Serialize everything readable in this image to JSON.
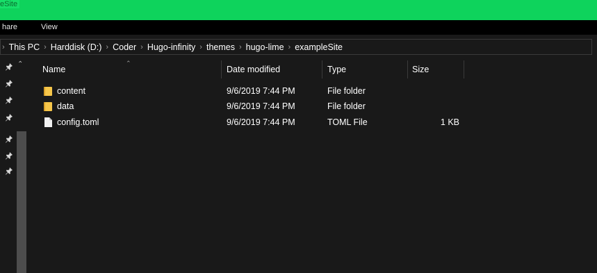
{
  "window": {
    "title": "eSite"
  },
  "ribbon": {
    "tabs": [
      "hare",
      "View"
    ]
  },
  "address": {
    "crumbs": [
      "This PC",
      "Harddisk (D:)",
      "Coder",
      "Hugo-infinity",
      "themes",
      "hugo-lime",
      "exampleSite"
    ]
  },
  "columns": {
    "name": "Name",
    "date": "Date modified",
    "type": "Type",
    "size": "Size"
  },
  "files": [
    {
      "name": "content",
      "date": "9/6/2019 7:44 PM",
      "type": "File folder",
      "size": "",
      "icon": "folder-icon"
    },
    {
      "name": "data",
      "date": "9/6/2019 7:44 PM",
      "type": "File folder",
      "size": "",
      "icon": "folder-icon"
    },
    {
      "name": "config.toml",
      "date": "9/6/2019 7:44 PM",
      "type": "TOML File",
      "size": "1 KB",
      "icon": "file-icon"
    }
  ],
  "colors": {
    "titlebar": "#0ed35c",
    "background": "#191919",
    "folder": "#f6c64a"
  }
}
